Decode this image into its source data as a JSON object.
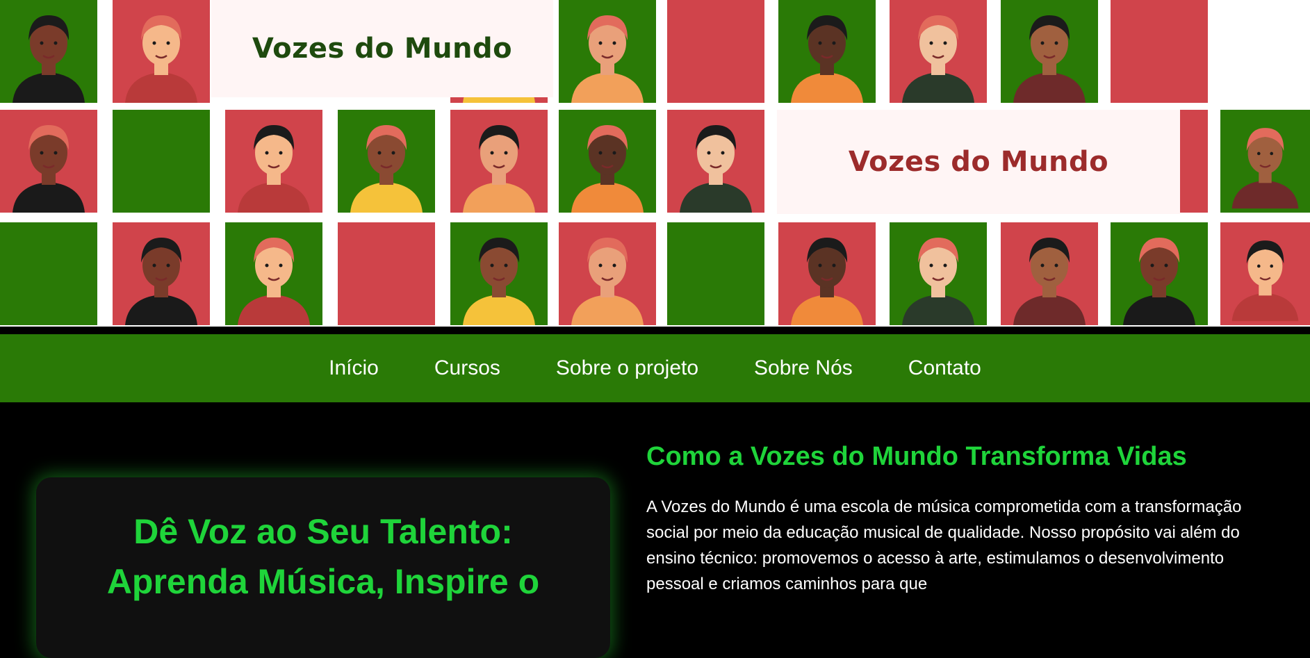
{
  "hero": {
    "brand_top": "Vozes do Mundo",
    "brand_middle": "Vozes do Mundo",
    "colors": {
      "green": "#2a7a06",
      "red": "#d0444b",
      "panel": "#fff5f5"
    }
  },
  "nav": {
    "items": [
      "Início",
      "Cursos",
      "Sobre o projeto",
      "Sobre Nós",
      "Contato"
    ]
  },
  "main": {
    "card_title": "Dê Voz ao Seu Talento: Aprenda Música, Inspire o",
    "about_title": "Como a Vozes do Mundo Transforma Vidas",
    "about_text": "A Vozes do Mundo é uma escola de música comprometida com a transformação social por meio da educação musical de qualidade. Nosso propósito vai além do ensino técnico: promovemos o acesso à arte, estimulamos o desenvolvimento pessoal e criamos caminhos para que",
    "accent_color": "#1fd43a"
  }
}
